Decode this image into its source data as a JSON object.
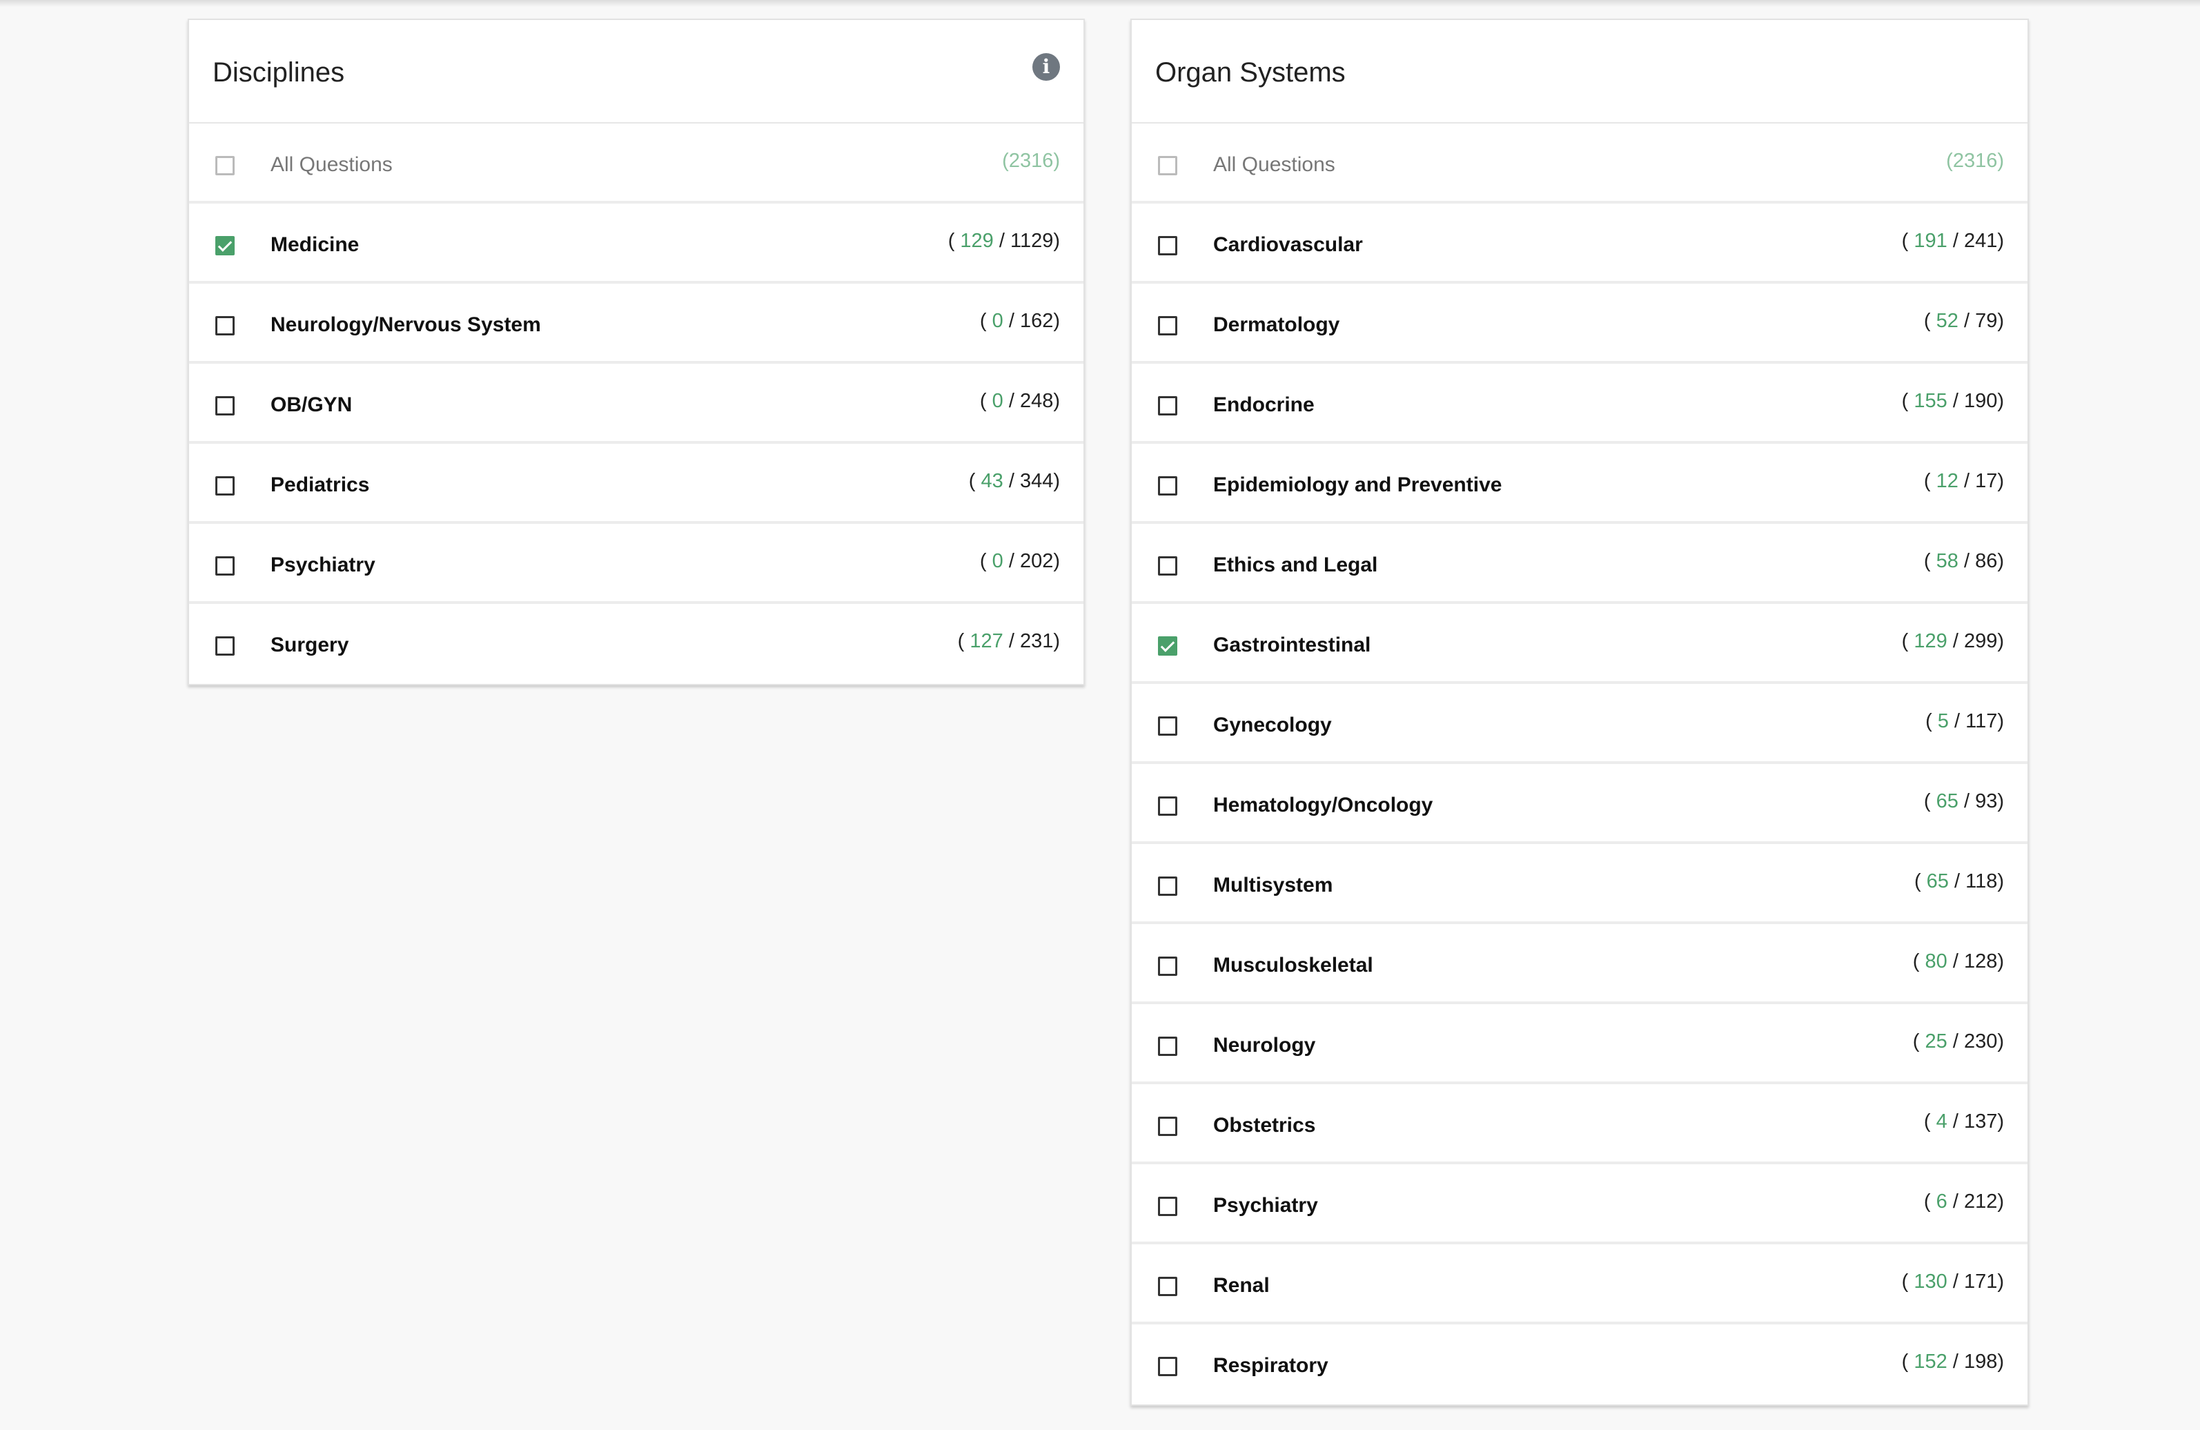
{
  "colors": {
    "accent_green": "#4aa06a",
    "info_icon": "#6f7780"
  },
  "disciplines": {
    "title": "Disciplines",
    "info_icon": "info-icon",
    "all": {
      "label": "All Questions",
      "count": "(2316)"
    },
    "items": [
      {
        "label": "Medicine",
        "checked": true,
        "count_open": "( ",
        "used": "129",
        "total": " / 1129)"
      },
      {
        "label": "Neurology/Nervous System",
        "checked": false,
        "count_open": "( ",
        "used": "0",
        "total": " / 162)"
      },
      {
        "label": "OB/GYN",
        "checked": false,
        "count_open": "( ",
        "used": "0",
        "total": " / 248)"
      },
      {
        "label": "Pediatrics",
        "checked": false,
        "count_open": "( ",
        "used": "43",
        "total": " / 344)"
      },
      {
        "label": "Psychiatry",
        "checked": false,
        "count_open": "( ",
        "used": "0",
        "total": " / 202)"
      },
      {
        "label": "Surgery",
        "checked": false,
        "count_open": "( ",
        "used": "127",
        "total": " / 231)"
      }
    ]
  },
  "organ_systems": {
    "title": "Organ Systems",
    "all": {
      "label": "All Questions",
      "count": "(2316)"
    },
    "items": [
      {
        "label": "Cardiovascular",
        "checked": false,
        "count_open": "( ",
        "used": "191",
        "total": " / 241)"
      },
      {
        "label": "Dermatology",
        "checked": false,
        "count_open": "( ",
        "used": "52",
        "total": " / 79)"
      },
      {
        "label": "Endocrine",
        "checked": false,
        "count_open": "( ",
        "used": "155",
        "total": " / 190)"
      },
      {
        "label": "Epidemiology and Preventive",
        "checked": false,
        "count_open": "( ",
        "used": "12",
        "total": " / 17)"
      },
      {
        "label": "Ethics and Legal",
        "checked": false,
        "count_open": "( ",
        "used": "58",
        "total": " / 86)"
      },
      {
        "label": "Gastrointestinal",
        "checked": true,
        "count_open": "( ",
        "used": "129",
        "total": " / 299)"
      },
      {
        "label": "Gynecology",
        "checked": false,
        "count_open": "( ",
        "used": "5",
        "total": " / 117)"
      },
      {
        "label": "Hematology/Oncology",
        "checked": false,
        "count_open": "( ",
        "used": "65",
        "total": " / 93)"
      },
      {
        "label": "Multisystem",
        "checked": false,
        "count_open": "( ",
        "used": "65",
        "total": " / 118)"
      },
      {
        "label": "Musculoskeletal",
        "checked": false,
        "count_open": "( ",
        "used": "80",
        "total": " / 128)"
      },
      {
        "label": "Neurology",
        "checked": false,
        "count_open": "( ",
        "used": "25",
        "total": " / 230)"
      },
      {
        "label": "Obstetrics",
        "checked": false,
        "count_open": "( ",
        "used": "4",
        "total": " / 137)"
      },
      {
        "label": "Psychiatry",
        "checked": false,
        "count_open": "( ",
        "used": "6",
        "total": " / 212)"
      },
      {
        "label": "Renal",
        "checked": false,
        "count_open": "( ",
        "used": "130",
        "total": " / 171)"
      },
      {
        "label": "Respiratory",
        "checked": false,
        "count_open": "( ",
        "used": "152",
        "total": " / 198)"
      }
    ]
  }
}
